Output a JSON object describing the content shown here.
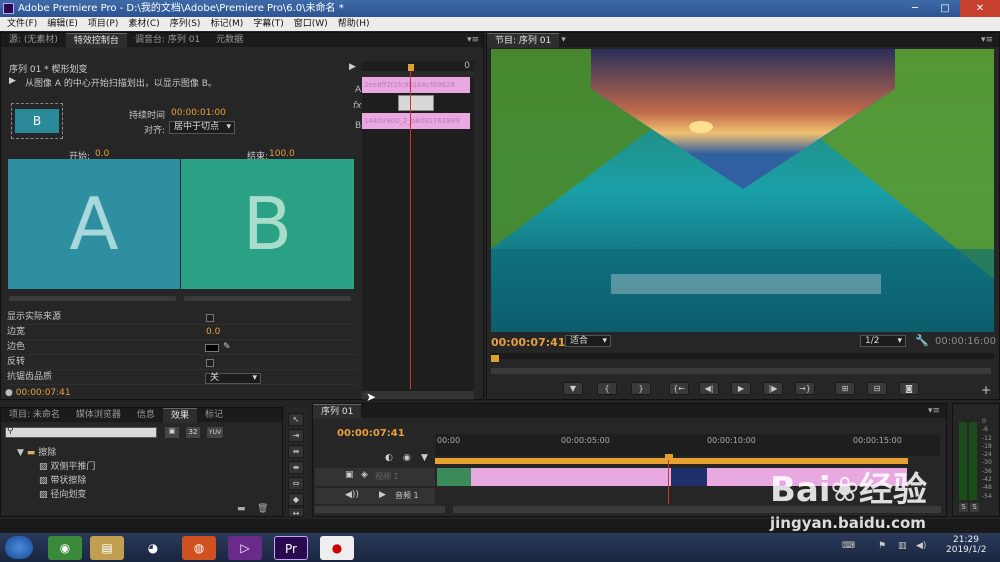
{
  "window": {
    "title": "Adobe Premiere Pro - D:\\我的文档\\Adobe\\Premiere Pro\\6.0\\未命名 *",
    "min": "─",
    "max": "□",
    "close": "✕"
  },
  "menu": [
    "文件(F)",
    "编辑(E)",
    "项目(P)",
    "素材(C)",
    "序列(S)",
    "标记(M)",
    "字幕(T)",
    "窗口(W)",
    "帮助(H)"
  ],
  "effect_controls": {
    "tabs": [
      "源: (无素材)",
      "特效控制台",
      "调音台: 序列 01",
      "元数据"
    ],
    "header": "序列 01 * 楔形划变",
    "description": "从图像 A 的中心开始扫描划出，以显示图像 B。",
    "duration_label": "持续时间",
    "duration_value": "00:00:01:00",
    "align_label": "对齐:",
    "align_value": "居中于切点",
    "start_label": "开始:",
    "start_value": "0.0",
    "end_label": "结束:",
    "end_value": "100.0",
    "letter_a": "A",
    "letter_b": "B",
    "track_a": "A",
    "track_b": "B",
    "fx": "fx",
    "clip_a_text": "2ee8ff2f2fc9b1b8cf69628",
    "clip_b_text": "1440x900_2_b8d91762889",
    "timeline_zero": "0",
    "props": [
      {
        "label": "显示实际来源"
      },
      {
        "label": "边宽",
        "value": "0.0"
      },
      {
        "label": "边色"
      },
      {
        "label": "反转"
      },
      {
        "label": "抗锯齿品质",
        "value": "关"
      }
    ],
    "timecode": "00:00:07:41"
  },
  "program": {
    "tab": "节目: 序列 01",
    "timecode": "00:00:07:41",
    "fit": "适合",
    "quality": "1/2",
    "duration": "00:00:16:00"
  },
  "project": {
    "tabs": [
      "项目: 未命名",
      "媒体浏览器",
      "信息",
      "效果",
      "标记"
    ],
    "folder": "擦除",
    "items": [
      "双侧平推门",
      "带状擦除",
      "径向划变"
    ],
    "badges": [
      "32",
      "YUV"
    ]
  },
  "timeline": {
    "tab": "序列 01",
    "timecode": "00:00:07:41",
    "ruler": [
      "00:00",
      "00:00:05:00",
      "00:00:10:00",
      "00:00:15:00"
    ],
    "video_track": "视频 1",
    "audio_track": "音频 1"
  },
  "meter": {
    "labels": [
      "0",
      "-6",
      "-12",
      "-18",
      "-24",
      "-30",
      "-36",
      "-42",
      "-48",
      "-54"
    ],
    "solo": "S"
  },
  "taskbar": {
    "time": "21:29",
    "date": "2019/1/2"
  },
  "watermark": {
    "brand": "Bai",
    "brand2": "经验",
    "url": "jingyan.baidu.com"
  }
}
